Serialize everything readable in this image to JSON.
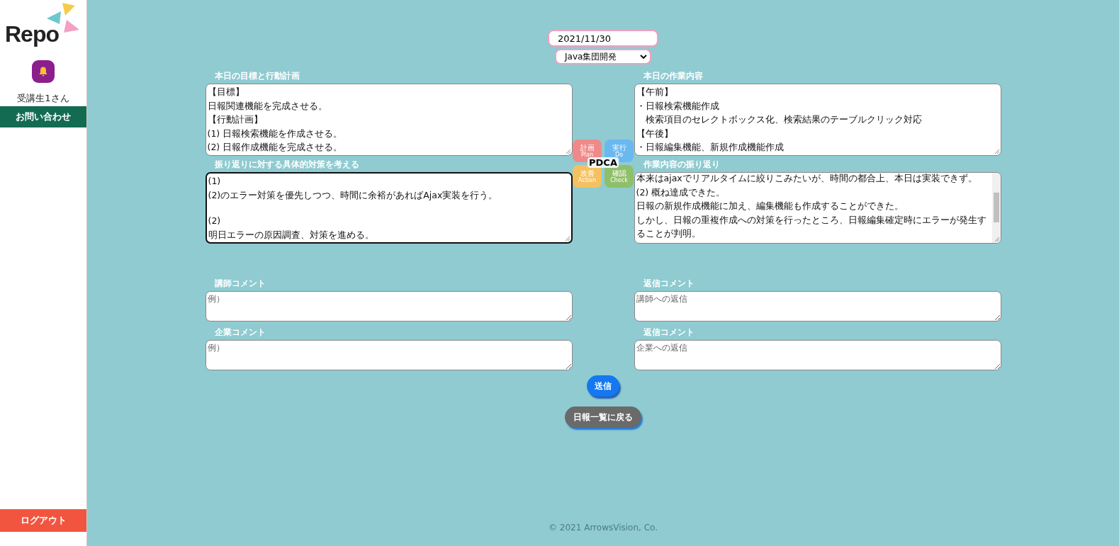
{
  "sidebar": {
    "logo": "Repo",
    "user": "受講生1さん",
    "contact": "お問い合わせ",
    "logout": "ログアウト"
  },
  "header": {
    "date": "2021/11/30",
    "group": "Java集団開発"
  },
  "sections": [
    {
      "label": "本日の目標と行動計画",
      "lines": [
        "【目標】",
        "日報関連機能を完成させる。",
        "【行動計画】",
        "(1) 日報検索機能を作成させる。",
        "(2) 日報作成機能を完成させる。"
      ],
      "focused": false,
      "scrollable": false
    },
    {
      "label": "本日の作業内容",
      "lines": [
        "【午前】",
        "・日報検索機能作成",
        "　検索項目のセレクトボックス化、検索結果のテーブルクリック対応",
        "【午後】",
        "・日報編集機能、新規作成機能作成"
      ],
      "focused": false,
      "scrollable": false
    },
    {
      "label": "振り返りに対する具体的対策を考える",
      "lines": [
        "(1)",
        "(2)のエラー対策を優先しつつ、時間に余裕があればAjax実装を行う。"
      ],
      "more_lines": [
        "(2)",
        "明日エラーの原因調査、対策を進める。"
      ],
      "focused": true,
      "scrollable": false
    },
    {
      "label": "作業内容の振り返り",
      "lines": [
        "本来はajaxでリアルタイムに絞りこみたいが、時間の都合上、本日は実装できず。",
        "(2) 概ね達成できた。",
        "日報の新規作成機能に加え、編集機能も作成することができた。",
        "しかし、日報の重複作成への対策を行ったところ、日報編集確定時にエラーが発生することが判明。"
      ],
      "focused": false,
      "scrollable": true
    }
  ],
  "pdca": {
    "title": "PDCA",
    "steps": [
      {
        "label": "計画",
        "sub": "Plan",
        "color": "#f08a8a"
      },
      {
        "label": "実行",
        "sub": "Do",
        "color": "#6ab8f0"
      },
      {
        "label": "改善",
        "sub": "Action",
        "color": "#f5c060"
      },
      {
        "label": "確認",
        "sub": "Check",
        "color": "#8fbf6a"
      }
    ]
  },
  "comments": [
    {
      "label": "講師コメント",
      "placeholder": "例）"
    },
    {
      "label": "返信コメント",
      "placeholder": "講師への返信"
    },
    {
      "label": "企業コメント",
      "placeholder": "例）"
    },
    {
      "label": "返信コメント",
      "placeholder": "企業への返信"
    }
  ],
  "buttons": {
    "send": "送信",
    "back": "日報一覧に戻る"
  },
  "footer": "© 2021 ArrowsVision, Co."
}
